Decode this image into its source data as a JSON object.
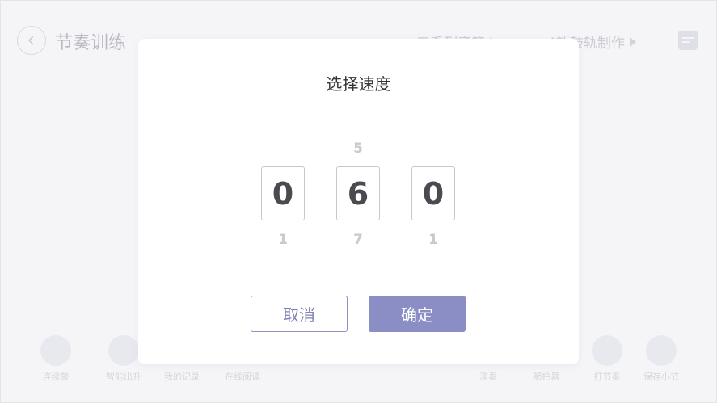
{
  "background": {
    "page_title": "节奏训练",
    "top_links": [
      {
        "label": "三系列音符"
      },
      {
        "label": "4轨鼓轨制作"
      }
    ],
    "tools_left": [
      {
        "label": "连续敲"
      },
      {
        "label": "智能出升"
      },
      {
        "label": "我的记录"
      },
      {
        "label": "在线阅读"
      }
    ],
    "tools_right": [
      {
        "label": "演奏"
      },
      {
        "label": "節拍器"
      },
      {
        "label": "打节奏"
      },
      {
        "label": "保存小节"
      }
    ]
  },
  "dialog": {
    "title": "选择速度",
    "digits": [
      {
        "above": "",
        "value": "0",
        "below": "1"
      },
      {
        "above": "5",
        "value": "6",
        "below": "7"
      },
      {
        "above": "",
        "value": "0",
        "below": "1"
      }
    ],
    "cancel_label": "取消",
    "confirm_label": "确定"
  },
  "colors": {
    "accent": "#8a8ec4",
    "accent_text": "#7d80b3"
  }
}
